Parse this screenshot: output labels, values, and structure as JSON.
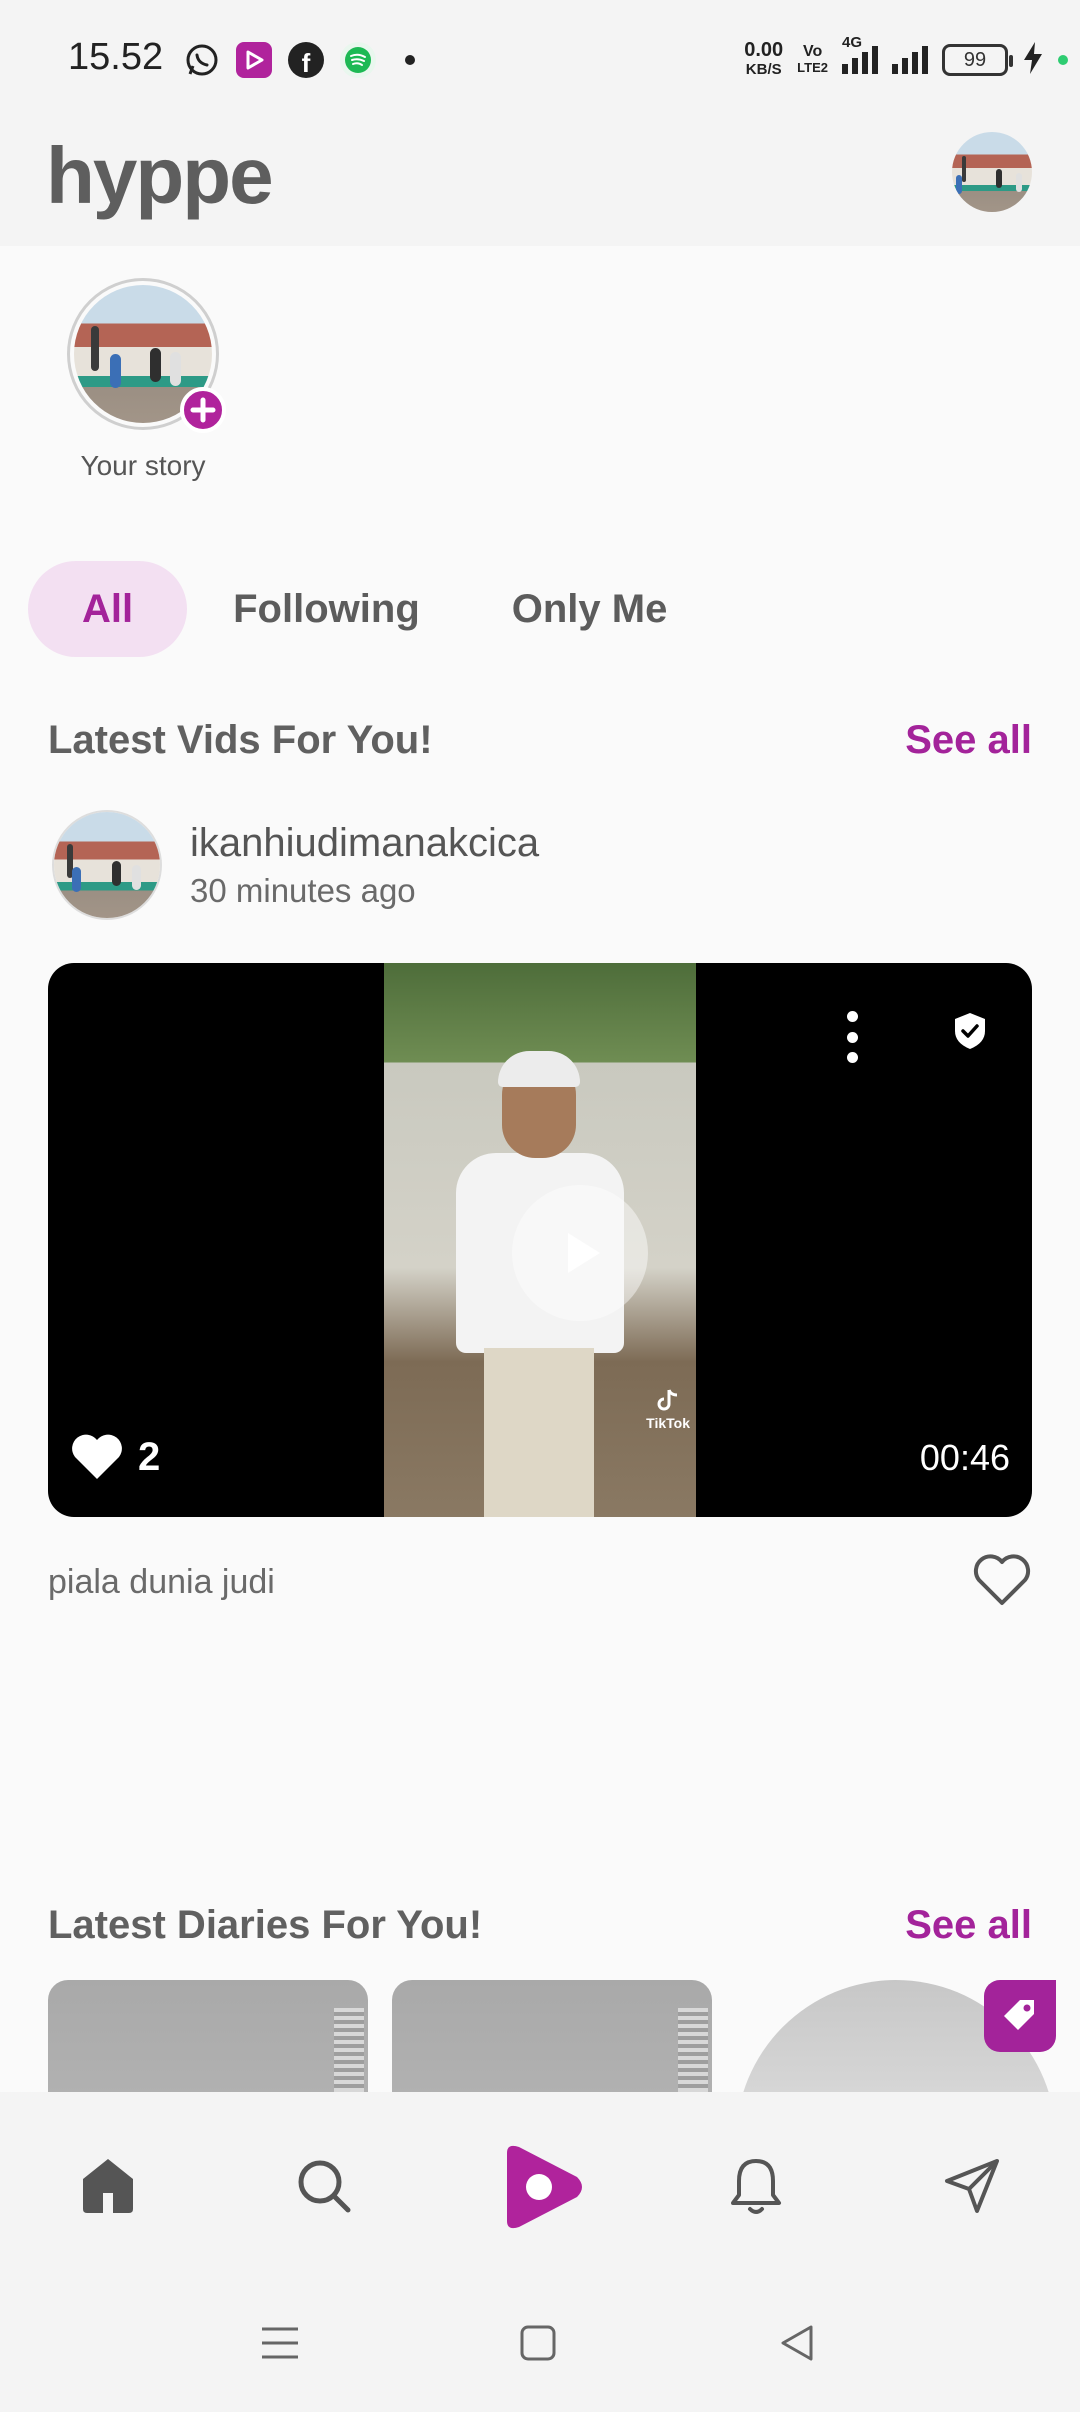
{
  "status_bar": {
    "time": "15.52",
    "net_speed_value": "0.00",
    "net_speed_unit": "KB/S",
    "volte_top": "Vo",
    "volte_bottom": "LTE2",
    "network_type": "4G",
    "battery": "99"
  },
  "header": {
    "logo": "hyppe"
  },
  "story": {
    "label": "Your story"
  },
  "tabs": [
    {
      "label": "All",
      "active": true
    },
    {
      "label": "Following",
      "active": false
    },
    {
      "label": "Only Me",
      "active": false
    }
  ],
  "vids_section": {
    "title": "Latest Vids For You!",
    "see_all": "See all"
  },
  "post": {
    "username": "ikanhiudimanakcica",
    "time_ago": "30 minutes ago",
    "likes": "2",
    "duration": "00:46",
    "watermark": "TikTok",
    "caption": "piala dunia judi"
  },
  "diaries_section": {
    "title": "Latest Diaries For You!",
    "see_all": "See all"
  },
  "colors": {
    "accent": "#a3239a",
    "tab_active_bg": "#f3e0f2",
    "text_gray": "#606060"
  },
  "bottom_nav": [
    "home-icon",
    "search-icon",
    "hyppe-play-icon",
    "bell-icon",
    "send-icon"
  ]
}
